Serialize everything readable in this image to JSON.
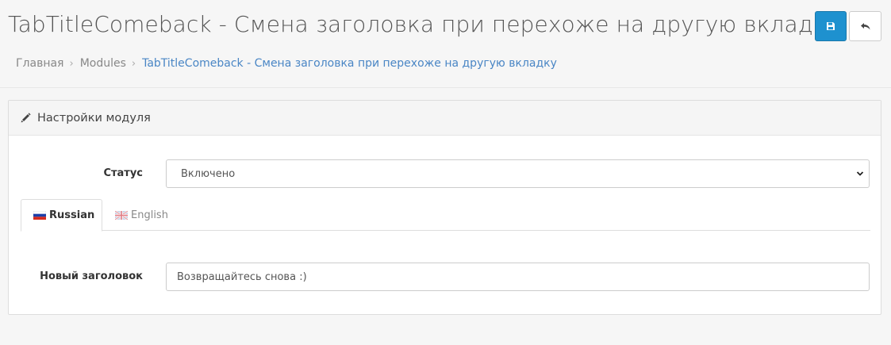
{
  "header": {
    "title": "TabTitleComeback - Смена заголовка при перехоже на другую вкладку",
    "save_icon": "save-icon",
    "back_icon": "reply-icon"
  },
  "breadcrumb": [
    {
      "label": "Главная"
    },
    {
      "label": "Modules"
    },
    {
      "label": "TabTitleComeback - Смена заголовка при перехоже на другую вкладку"
    }
  ],
  "panel": {
    "title": "Настройки модуля",
    "icon": "pencil-icon"
  },
  "form": {
    "status_label": "Статус",
    "status_value": "Включено",
    "tabs": [
      {
        "label": "Russian",
        "flag": "ru-flag-icon",
        "active": true
      },
      {
        "label": "English",
        "flag": "gb-flag-icon",
        "active": false
      }
    ],
    "new_title_label": "Новый заголовок",
    "new_title_value": "Возвращайтесь снова :)"
  },
  "colors": {
    "primary": "#1e91cf",
    "link": "#4a86c5"
  }
}
